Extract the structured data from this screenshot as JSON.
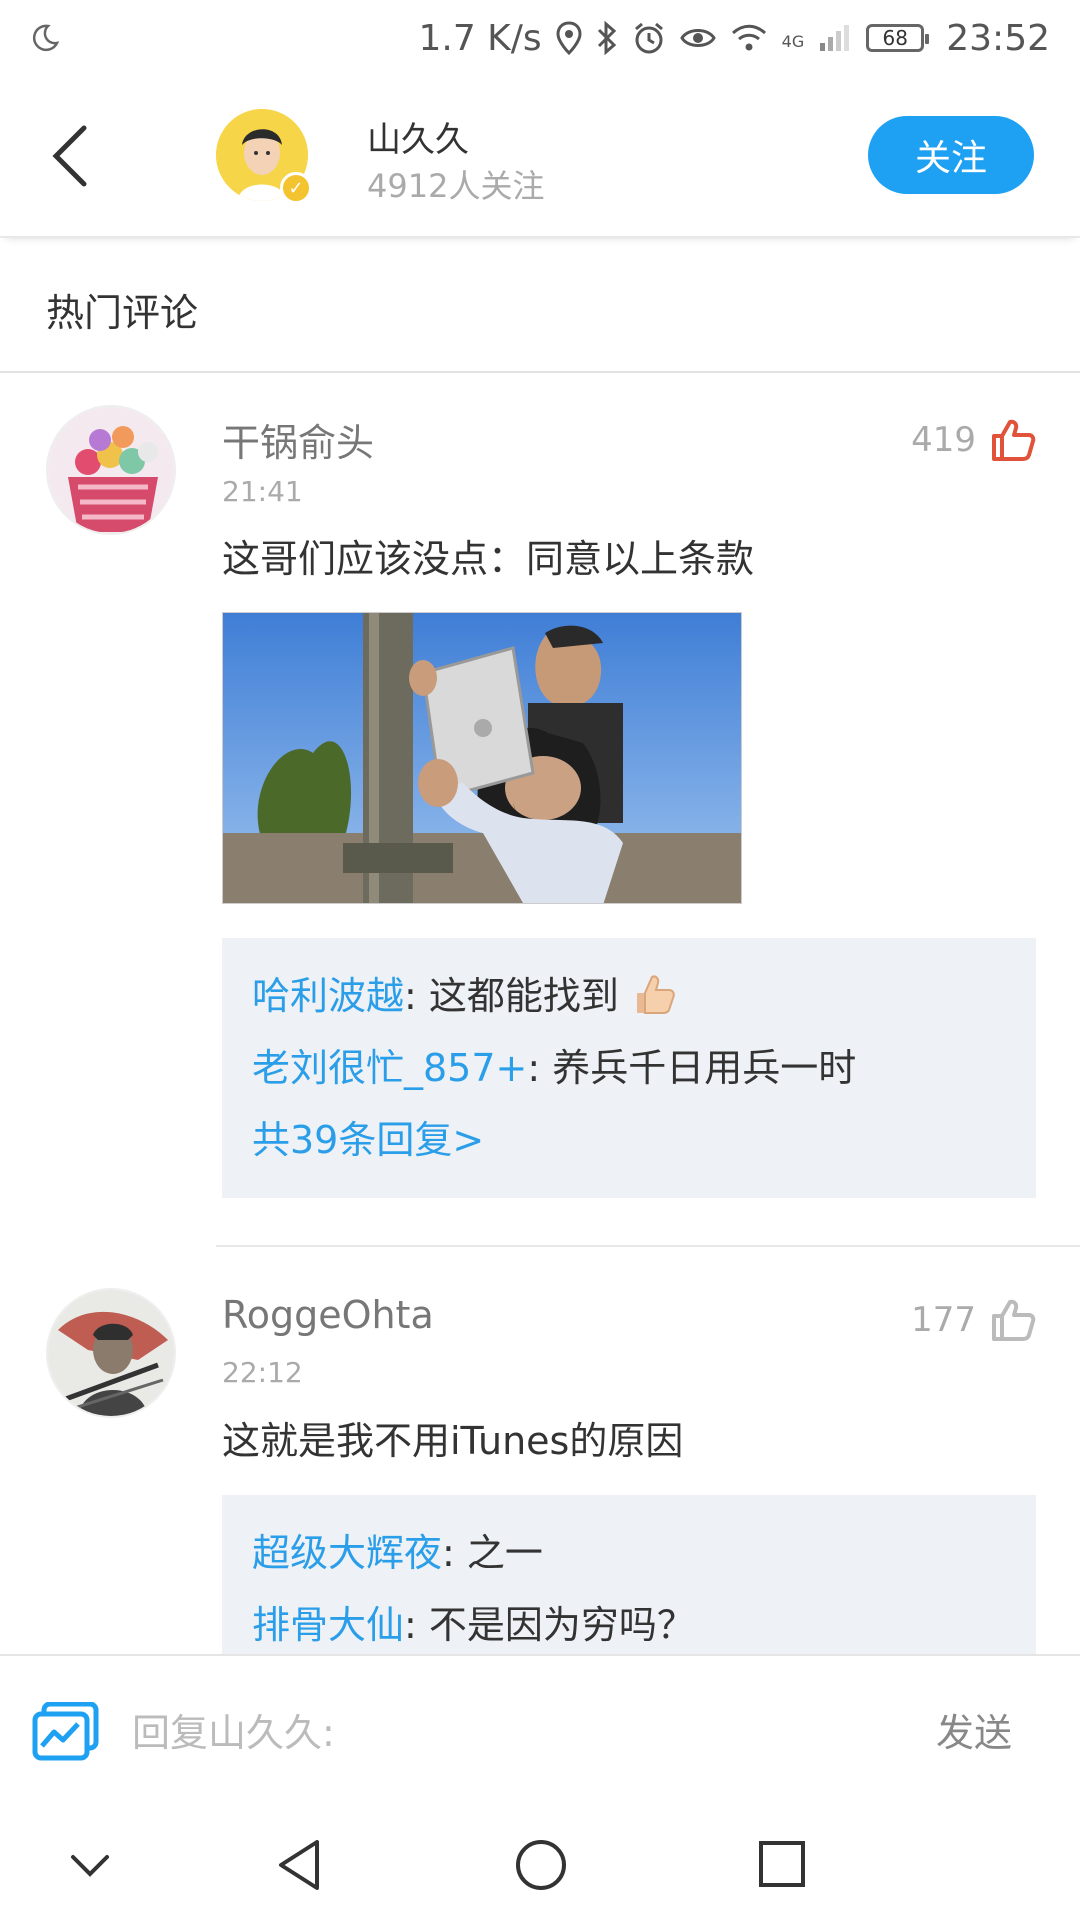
{
  "status_bar": {
    "speed": "1.7 K/s",
    "network": "4G",
    "battery": "68",
    "time": "23:52",
    "icons": [
      "moon-icon",
      "location-icon",
      "bluetooth-icon",
      "alarm-icon",
      "eye-icon",
      "wifi-icon",
      "signal-icon",
      "battery-icon"
    ]
  },
  "header": {
    "author_name": "山久久",
    "followers": "4912人关注",
    "follow_label": "关注"
  },
  "section": {
    "title": "热门评论"
  },
  "comments": [
    {
      "name": "干锅俞头",
      "time": "21:41",
      "likes": "419",
      "text": "这哥们应该没点：同意以上条款",
      "replies": [
        {
          "user": "哈利波越",
          "text": ": 这都能找到"
        },
        {
          "user": "老刘很忙_857+",
          "text": ": 养兵千日用兵一时"
        }
      ],
      "more": "共39条回复>"
    },
    {
      "name": "RoggeOhta",
      "time": "22:12",
      "likes": "177",
      "text": "这就是我不用iTunes的原因",
      "replies": [
        {
          "user": "超级大辉夜",
          "text": ": 之一"
        },
        {
          "user": "排骨大仙",
          "text": ": 不是因为穷吗？"
        }
      ]
    }
  ],
  "input_bar": {
    "placeholder": "回复山久久:",
    "send_label": "发送"
  },
  "colors": {
    "accent": "#1ea1f2",
    "link": "#2a9ee8",
    "like_active": "#e0533a"
  }
}
